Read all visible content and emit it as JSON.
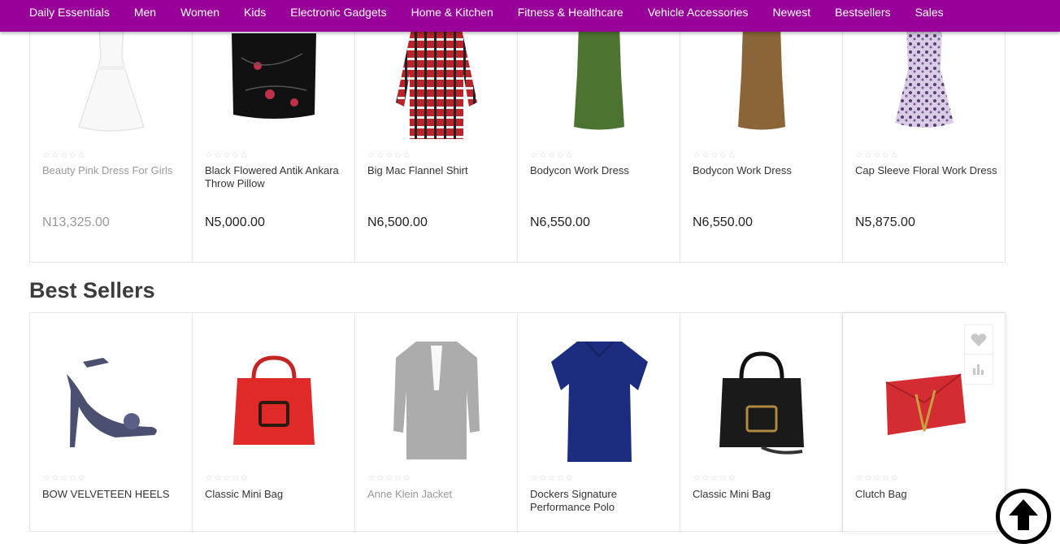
{
  "nav": {
    "items": [
      "Daily Essentials",
      "Men",
      "Women",
      "Kids",
      "Electronic Gadgets",
      "Home & Kitchen",
      "Fitness & Healthcare",
      "Vehicle Accessories",
      "Newest",
      "Bestsellers",
      "Sales"
    ]
  },
  "top_products": [
    {
      "name": "Beauty Pink Dress For Girls",
      "price": "N13,325.00",
      "stars": "☆☆☆☆☆",
      "icon": "white-lace-dress"
    },
    {
      "name": "Black Flowered Antik Ankara Throw Pillow",
      "price": "N5,000.00",
      "stars": "☆☆☆☆☆",
      "icon": "black-floral-pillow"
    },
    {
      "name": "Big Mac Flannel Shirt",
      "price": "N6,500.00",
      "stars": "☆☆☆☆☆",
      "icon": "plaid-shirt"
    },
    {
      "name": "Bodycon Work Dress",
      "price": "N6,550.00",
      "stars": "☆☆☆☆☆",
      "icon": "green-dress"
    },
    {
      "name": "Bodycon Work Dress",
      "price": "N6,550.00",
      "stars": "☆☆☆☆☆",
      "icon": "brown-dress"
    },
    {
      "name": "Cap Sleeve Floral Work Dress",
      "price": "N5,875.00",
      "stars": "☆☆☆☆☆",
      "icon": "floral-dress"
    }
  ],
  "best_sellers": {
    "title": "Best Sellers",
    "products": [
      {
        "name": "BOW VELVETEEN HEELS",
        "stars": "☆☆☆☆☆",
        "icon": "heel-shoe"
      },
      {
        "name": "Classic Mini Bag",
        "stars": "☆☆☆☆☆",
        "icon": "red-handbag"
      },
      {
        "name": "Anne Klein Jacket",
        "stars": "☆☆☆☆☆",
        "icon": "grey-jacket"
      },
      {
        "name": "Dockers Signature Performance Polo",
        "stars": "☆☆☆☆☆",
        "icon": "navy-polo"
      },
      {
        "name": "Classic Mini Bag",
        "stars": "☆☆☆☆☆",
        "icon": "black-handbag"
      },
      {
        "name": "Clutch Bag",
        "stars": "☆☆☆☆☆",
        "icon": "red-clutch"
      }
    ]
  },
  "colors": {
    "nav_bg": "#990099",
    "nav_text": "#ffffff"
  }
}
